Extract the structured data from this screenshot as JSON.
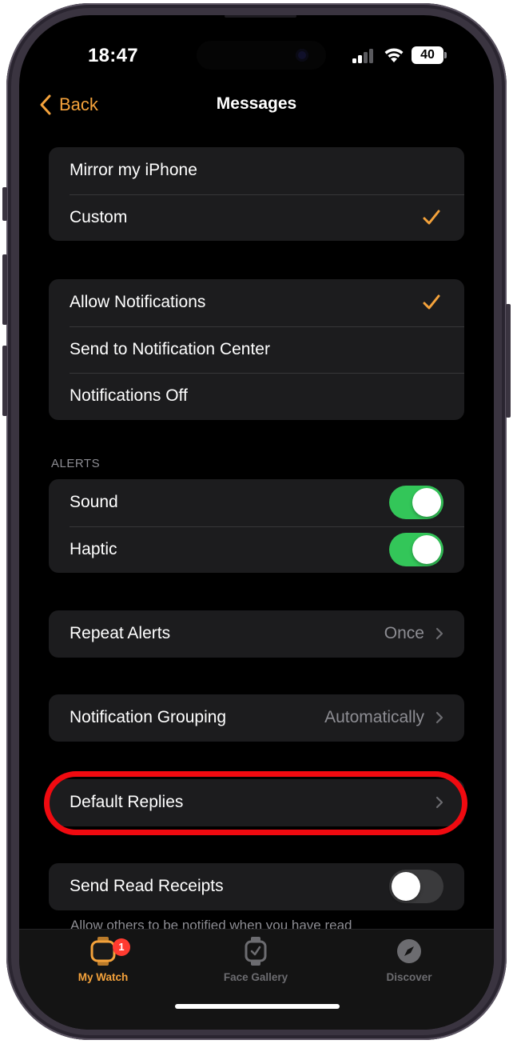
{
  "status_bar": {
    "time": "18:47",
    "battery": "40"
  },
  "nav": {
    "back_label": "Back",
    "title": "Messages"
  },
  "mirror_group": {
    "items": [
      {
        "label": "Mirror my iPhone",
        "checked": false
      },
      {
        "label": "Custom",
        "checked": true
      }
    ]
  },
  "notification_group": {
    "items": [
      {
        "label": "Allow Notifications",
        "checked": true
      },
      {
        "label": "Send to Notification Center",
        "checked": false
      },
      {
        "label": "Notifications Off",
        "checked": false
      }
    ]
  },
  "alerts": {
    "header": "ALERTS",
    "sound_label": "Sound",
    "sound_on": true,
    "haptic_label": "Haptic",
    "haptic_on": true
  },
  "repeat_alerts": {
    "label": "Repeat Alerts",
    "value": "Once"
  },
  "notification_grouping": {
    "label": "Notification Grouping",
    "value": "Automatically"
  },
  "default_replies": {
    "label": "Default Replies"
  },
  "read_receipts": {
    "label": "Send Read Receipts",
    "on": false,
    "footer": "Allow others to be notified when you have read"
  },
  "tab_bar": {
    "my_watch": "My Watch",
    "my_watch_badge": "1",
    "face_gallery": "Face Gallery",
    "discover": "Discover"
  },
  "colors": {
    "accent": "#f4a23b",
    "toggle_on": "#33c659",
    "highlight": "#f00a10",
    "badge": "#ff3b30"
  },
  "icons": {
    "back": "chevron-left-icon",
    "check": "checkmark-icon",
    "disclosure": "chevron-right-icon",
    "my_watch": "watch-icon",
    "face_gallery": "watch-face-icon",
    "discover": "compass-icon"
  }
}
